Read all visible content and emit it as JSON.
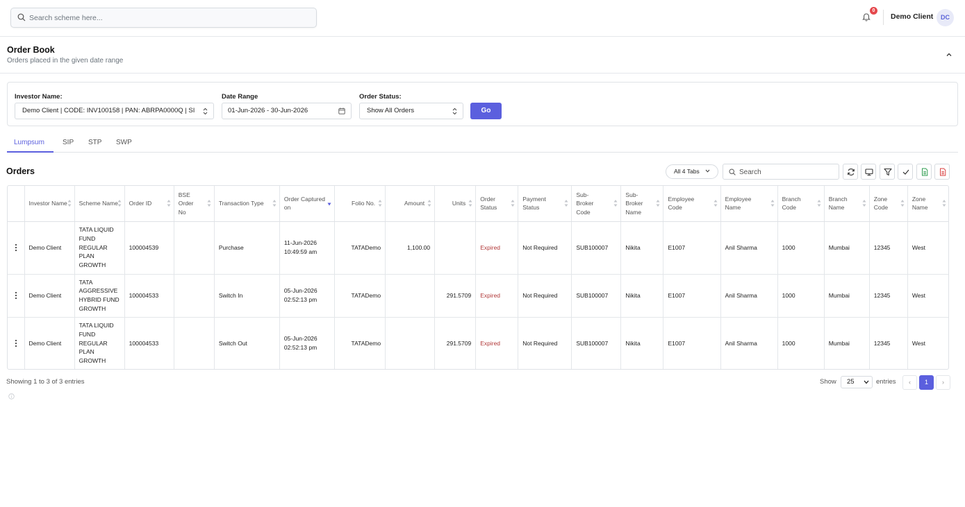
{
  "header": {
    "search_placeholder": "Search scheme here...",
    "notification_count": "0",
    "user_name": "Demo Client",
    "avatar_initials": "DC"
  },
  "page": {
    "title": "Order Book",
    "subtitle": "Orders placed in the given date range"
  },
  "filters": {
    "investor_label": "Investor Name:",
    "investor_value": "Demo Client | CODE: INV100158 | PAN: ABRPA0000Q | SI",
    "date_label": "Date Range",
    "date_value": "01-Jun-2026 - 30-Jun-2026",
    "status_label": "Order Status:",
    "status_value": "Show All Orders",
    "go_label": "Go"
  },
  "tabs": [
    "Lumpsum",
    "SIP",
    "STP",
    "SWP"
  ],
  "active_tab": "Lumpsum",
  "orders": {
    "title": "Orders",
    "all_tabs_label": "All 4 Tabs",
    "search_placeholder": "Search",
    "columns": [
      "Investor Name",
      "Scheme Name",
      "Order ID",
      "BSE Order No",
      "Transaction Type",
      "Order Captured on",
      "Folio No.",
      "Amount",
      "Units",
      "Order Status",
      "Payment Status",
      "Sub-Broker Code",
      "Sub-Broker Name",
      "Employee Code",
      "Employee Name",
      "Branch Code",
      "Branch Name",
      "Zone Code",
      "Zone Name"
    ],
    "rows": [
      {
        "investor": "Demo Client",
        "scheme": "TATA LIQUID FUND REGULAR PLAN GROWTH",
        "order_id": "100004539",
        "bse_order_no": "",
        "transaction_type": "Purchase",
        "captured_on": "11-Jun-2026 10:49:59 am",
        "folio": "TATADemo",
        "amount": "1,100.00",
        "units": "",
        "order_status": "Expired",
        "payment_status": "Not Required",
        "sub_broker_code": "SUB100007",
        "sub_broker_name": "Nikita",
        "employee_code": "E1007",
        "employee_name": "Anil Sharma",
        "branch_code": "1000",
        "branch_name": "Mumbai",
        "zone_code": "12345",
        "zone_name": "West"
      },
      {
        "investor": "Demo Client",
        "scheme": "TATA AGGRESSIVE HYBRID FUND GROWTH",
        "order_id": "100004533",
        "bse_order_no": "",
        "transaction_type": "Switch In",
        "captured_on": "05-Jun-2026 02:52:13 pm",
        "folio": "TATADemo",
        "amount": "",
        "units": "291.5709",
        "order_status": "Expired",
        "payment_status": "Not Required",
        "sub_broker_code": "SUB100007",
        "sub_broker_name": "Nikita",
        "employee_code": "E1007",
        "employee_name": "Anil Sharma",
        "branch_code": "1000",
        "branch_name": "Mumbai",
        "zone_code": "12345",
        "zone_name": "West"
      },
      {
        "investor": "Demo Client",
        "scheme": "TATA LIQUID FUND REGULAR PLAN GROWTH",
        "order_id": "100004533",
        "bse_order_no": "",
        "transaction_type": "Switch Out",
        "captured_on": "05-Jun-2026 02:52:13 pm",
        "folio": "TATADemo",
        "amount": "",
        "units": "291.5709",
        "order_status": "Expired",
        "payment_status": "Not Required",
        "sub_broker_code": "SUB100007",
        "sub_broker_name": "Nikita",
        "employee_code": "E1007",
        "employee_name": "Anil Sharma",
        "branch_code": "1000",
        "branch_name": "Mumbai",
        "zone_code": "12345",
        "zone_name": "West"
      }
    ]
  },
  "footer": {
    "showing_text": "Showing 1 to 3 of 3 entries",
    "show_label": "Show",
    "page_size": "25",
    "entries_label": "entries",
    "prev": "‹",
    "current_page": "1",
    "next": "›"
  },
  "colors": {
    "accent": "#5b5fde",
    "expired": "#b23a3a",
    "badge": "#e5484d"
  }
}
